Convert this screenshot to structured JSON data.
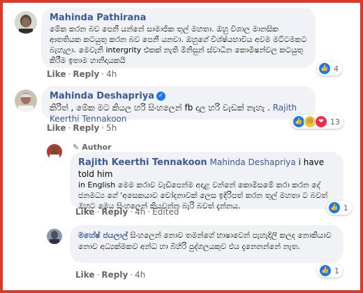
{
  "comments": [
    {
      "author": "Mahinda Pathirana",
      "text": "මේක කරන බව පෙනී යන්නේ සාමාජික තුල් මහතා. ඔහු විශාල මානසික ආතතියක කටයුතු කරන බව පෙනී යනවා. ඔහුගේ විශ්ෂ්යභාවිය අවම මට්ටමකට බැහැලා. මෙවැනි intergrity එකක් නැති මිනිසුන් ස්වාධීන කොමිෂන්වල කටයුතු කිරීම ඉතාම හානිදායකයි",
      "actions": [
        "Like",
        "Reply"
      ],
      "time": "4h",
      "reaction_count": "4"
    },
    {
      "author": "Mahinda Deshapriya",
      "text": "කිරිත් , මේක මට කියල හරි සිංහලෙන් fb දාල හරි වැඩක් නැහැ .",
      "mention": "Rajith Keerthi Tennakoon",
      "actions": [
        "Like",
        "Reply"
      ],
      "time": "5h",
      "reaction_count": "13"
    },
    {
      "author_tag": "Author",
      "author": "Rajith Keerthi Tennakoon",
      "mention": "Mahinda Deshapriya",
      "text_line1": "i have told him",
      "text_rest": "in English මෙම කරාව වැඩිපෙන්ම අදාළ වන්නේ කොමිසමේ කරා කරන දේ ජනමධ්‍ය ගේ 'අසෙකයාව චෝදනාවක් ලෙස ඉදිරිපත් කරන තුල් මහතා ට බවත් ඔහුට මෙය සිංහලෙන් කියවන්න බැරි බවත් දැන්නය.",
      "actions": [
        "Like",
        "Reply"
      ],
      "time": "4h",
      "edited": "Edited",
      "reaction_count": "1"
    },
    {
      "author": "මහේෂ් ජයලාල්",
      "text": "සිංහලෙන් නොව තමන්ගේ භාෂාවෙන් පැහැදිලි කලද නොකියාව නොව අධ්‍යක්මකව අන්ධ හා බිහිරි පුද්ගලයකුව එය දැනෙනන්නේ නැත.",
      "actions": [
        "Like",
        "Reply"
      ],
      "time": "4h",
      "reaction_count": "1"
    }
  ],
  "colors": {
    "frame": "#d93a2b",
    "name": "#3b5998",
    "bubble": "#f0f2f5",
    "like": "#1877f2"
  }
}
